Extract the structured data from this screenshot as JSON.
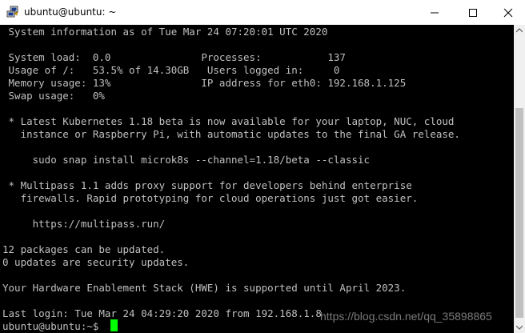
{
  "window": {
    "title": "ubuntu@ubuntu: ~",
    "app_icon": "putty-icon",
    "controls": [
      "minimize-icon",
      "maximize-icon",
      "close-icon"
    ]
  },
  "terminal": {
    "background": "#000000",
    "foreground": "#c0c0c0",
    "cursor_color": "#00ff00",
    "lines": [
      " System information as of Tue Mar 24 07:20:01 UTC 2020",
      "",
      " System load:  0.0               Processes:           137",
      " Usage of /:   53.5% of 14.30GB   Users logged in:     0",
      " Memory usage: 13%               IP address for eth0: 192.168.1.125",
      " Swap usage:   0%",
      "",
      " * Latest Kubernetes 1.18 beta is now available for your laptop, NUC, cloud",
      "   instance or Raspberry Pi, with automatic updates to the final GA release.",
      "",
      "     sudo snap install microk8s --channel=1.18/beta --classic",
      "",
      " * Multipass 1.1 adds proxy support for developers behind enterprise",
      "   firewalls. Rapid prototyping for cloud operations just got easier.",
      "",
      "     https://multipass.run/",
      "",
      "12 packages can be updated.",
      "0 updates are security updates.",
      "",
      "Your Hardware Enablement Stack (HWE) is supported until April 2023.",
      "",
      "Last login: Tue Mar 24 04:29:20 2020 from 192.168.1.8",
      "ubuntu@ubuntu:~$ "
    ]
  },
  "watermark": "https://blog.csdn.net/qq_35898865"
}
